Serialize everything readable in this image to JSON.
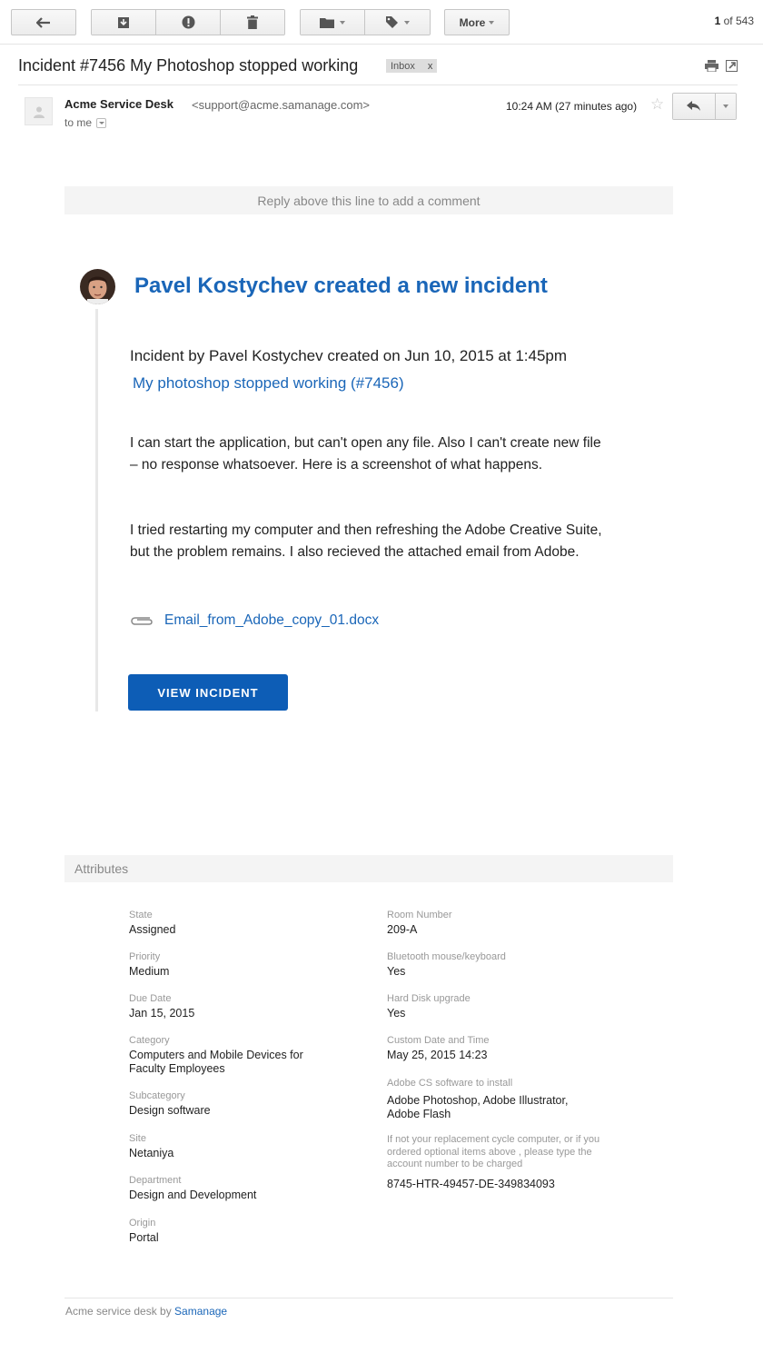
{
  "toolbar": {
    "back_icon": "arrow-left-icon",
    "archive_icon": "archive-icon",
    "spam_icon": "exclamation-icon",
    "delete_icon": "trash-icon",
    "folder_icon": "folder-icon",
    "label_icon": "tag-icon",
    "more_label": "More",
    "pager_current": "1",
    "pager_rest": " of 543"
  },
  "email": {
    "subject": "Incident #7456 My Photoshop stopped working",
    "label": "Inbox",
    "label_close": "x",
    "sender_name": "Acme Service Desk",
    "sender_email": "<support@acme.samanage.com>",
    "to": "to me",
    "time": "10:24 AM (27 minutes ago)"
  },
  "body": {
    "reply_line": "Reply above this line to add a comment",
    "title": "Pavel Kostychev created a new incident",
    "created_line": "Incident by Pavel Kostychev created on Jun 10, 2015 at 1:45pm",
    "incident_link": "My photoshop stopped working (#7456)",
    "paragraph1": "I can start the application, but can't open any file. Also I can't create new file – no response whatsoever. Here is a screenshot of what happens.",
    "paragraph2": "I tried restarting my computer and then refreshing the Adobe Creative Suite, but the problem remains. I also recieved the attached email from Adobe.",
    "attachment": "Email_from_Adobe_copy_01.docx",
    "view_button": "VIEW INCIDENT"
  },
  "attributes": {
    "header": "Attributes",
    "left": [
      {
        "label": "State",
        "value": "Assigned"
      },
      {
        "label": "Priority",
        "value": "Medium"
      },
      {
        "label": "Due Date",
        "value": "Jan 15, 2015"
      },
      {
        "label": "Category",
        "value": "Computers and Mobile Devices for Faculty Employees"
      },
      {
        "label": "Subcategory",
        "value": "Design software"
      },
      {
        "label": "Site",
        "value": "Netaniya"
      },
      {
        "label": "Department",
        "value": "Design and Development"
      },
      {
        "label": "Origin",
        "value": "Portal"
      }
    ],
    "right": [
      {
        "label": "Room Number",
        "value": "209-A"
      },
      {
        "label": "Bluetooth mouse/keyboard",
        "value": "Yes"
      },
      {
        "label": "Hard Disk upgrade",
        "value": "Yes"
      },
      {
        "label": "Custom Date and Time",
        "value": "May 25, 2015 14:23"
      },
      {
        "label": "Adobe CS software to install",
        "value": "Adobe Photoshop, Adobe Illustrator, Adobe Flash"
      },
      {
        "label": "If not your replacement cycle computer, or if you ordered optional items above , please type the account number to be charged",
        "value": "8745-HTR-49457-DE-349834093"
      }
    ]
  },
  "footer": {
    "prefix": "Acme service desk by ",
    "link": "Samanage"
  }
}
